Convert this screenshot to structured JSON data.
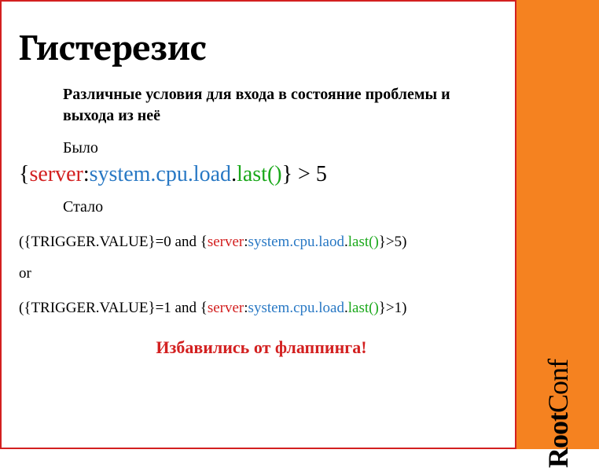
{
  "title": "Гистерезис",
  "subtitle": "Различные условия для входа в состояние проблемы и выхода из неё",
  "label_before": "Было",
  "label_after": "Стало",
  "expr_before": {
    "open": "{",
    "server": "server",
    "colon": ":",
    "key": "system.cpu.load",
    "dot": ".",
    "fn": "last()",
    "close": "}",
    "tail": " > 5"
  },
  "expr_after_1": {
    "pre": "({TRIGGER.VALUE}=0 and {",
    "server": "server",
    "colon": ":",
    "key": "system.cpu.laod",
    "dot": ".",
    "fn": "last()",
    "post": "}>5)"
  },
  "or_text": "or",
  "expr_after_2": {
    "pre": "({TRIGGER.VALUE}=1 and {",
    "server": "server",
    "colon": ":",
    "key": "system.cpu.load",
    "dot": ".",
    "fn": "last()",
    "post": "}>1)"
  },
  "footer": "Избавились от флаппинга!",
  "logo": {
    "root": "Root",
    "conf": "Conf"
  }
}
